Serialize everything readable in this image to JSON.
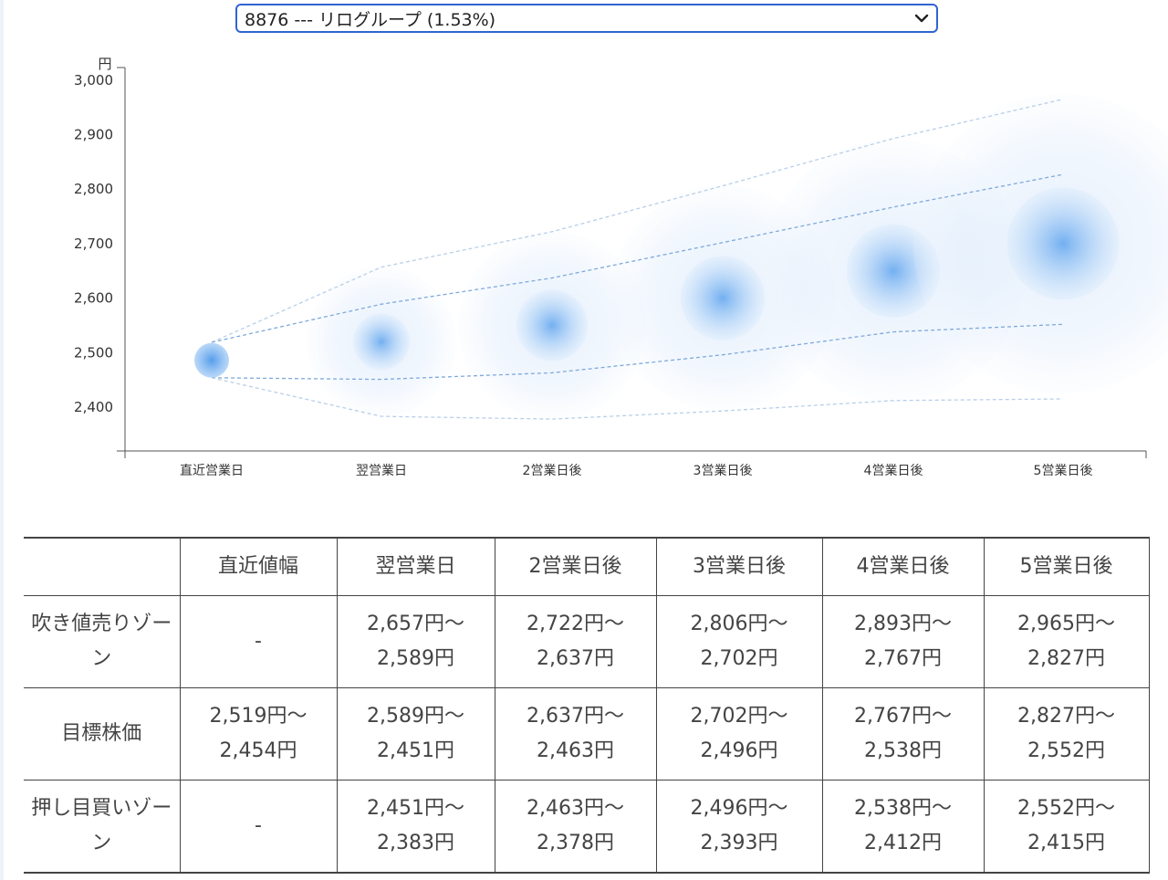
{
  "selector": {
    "value": "8876 --- リログループ (1.53%)"
  },
  "chart_data": {
    "type": "scatter",
    "ylabel": "円",
    "ylim": [
      2400,
      3000
    ],
    "yticks": [
      "3,000",
      "2,900",
      "2,800",
      "2,700",
      "2,600",
      "2,500",
      "2,400"
    ],
    "ytick_values": [
      3000,
      2900,
      2800,
      2700,
      2600,
      2500,
      2400
    ],
    "categories": [
      "直近営業日",
      "翌営業日",
      "2営業日後",
      "3営業日後",
      "4営業日後",
      "5営業日後"
    ],
    "center": [
      2486,
      2520,
      2550,
      2600,
      2650,
      2700
    ],
    "upper_outer": [
      2519,
      2657,
      2722,
      2806,
      2893,
      2965
    ],
    "upper_inner": [
      2519,
      2589,
      2637,
      2702,
      2767,
      2827
    ],
    "lower_inner": [
      2454,
      2451,
      2463,
      2496,
      2538,
      2552
    ],
    "lower_outer": [
      2454,
      2383,
      2378,
      2393,
      2412,
      2415
    ],
    "accent_color": "#5a9be6"
  },
  "table": {
    "headers": [
      "",
      "直近値幅",
      "翌営業日",
      "2営業日後",
      "3営業日後",
      "4営業日後",
      "5営業日後"
    ],
    "rows": [
      {
        "label": "吹き値売りゾーン",
        "cells": [
          {
            "line1": "-",
            "line2": ""
          },
          {
            "line1": "2,657円〜",
            "line2": "2,589円"
          },
          {
            "line1": "2,722円〜",
            "line2": "2,637円"
          },
          {
            "line1": "2,806円〜",
            "line2": "2,702円"
          },
          {
            "line1": "2,893円〜",
            "line2": "2,767円"
          },
          {
            "line1": "2,965円〜",
            "line2": "2,827円"
          }
        ]
      },
      {
        "label": "目標株価",
        "cells": [
          {
            "line1": "2,519円〜",
            "line2": "2,454円"
          },
          {
            "line1": "2,589円〜",
            "line2": "2,451円"
          },
          {
            "line1": "2,637円〜",
            "line2": "2,463円"
          },
          {
            "line1": "2,702円〜",
            "line2": "2,496円"
          },
          {
            "line1": "2,767円〜",
            "line2": "2,538円"
          },
          {
            "line1": "2,827円〜",
            "line2": "2,552円"
          }
        ]
      },
      {
        "label": "押し目買いゾーン",
        "cells": [
          {
            "line1": "-",
            "line2": ""
          },
          {
            "line1": "2,451円〜",
            "line2": "2,383円"
          },
          {
            "line1": "2,463円〜",
            "line2": "2,378円"
          },
          {
            "line1": "2,496円〜",
            "line2": "2,393円"
          },
          {
            "line1": "2,538円〜",
            "line2": "2,412円"
          },
          {
            "line1": "2,552円〜",
            "line2": "2,415円"
          }
        ]
      }
    ]
  }
}
